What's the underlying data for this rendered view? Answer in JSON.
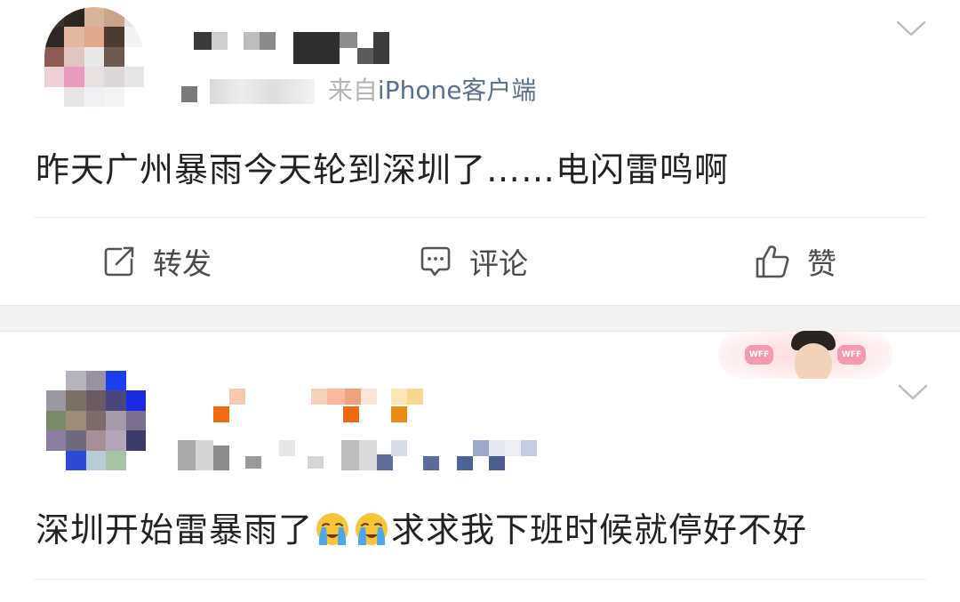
{
  "colors": {
    "divider_band": "#f2f2f2",
    "text_primary": "#222222",
    "text_secondary": "#9a9a9a",
    "client_link": "#5b6f8f",
    "action_text": "#4a4a4a"
  },
  "feed": {
    "posts": [
      {
        "username_blurred": true,
        "time_blurred": "分钟前",
        "source_prefix": "来自",
        "source_client": "iPhone客户端",
        "content": "昨天广州暴雨今天轮到深圳了……电闪雷鸣啊",
        "actions": {
          "repost_label": "转发",
          "comment_label": "评论",
          "like_label": "赞"
        },
        "menu_icon": "chevron-down-icon"
      },
      {
        "username_blurred": true,
        "badge": "WFF",
        "content_part1": "深圳开始雷暴雨了",
        "emoji_1": "crying-face",
        "emoji_2": "crying-face",
        "content_part2": "求求我下班时候就停好不好",
        "menu_icon": "chevron-down-icon"
      }
    ]
  }
}
